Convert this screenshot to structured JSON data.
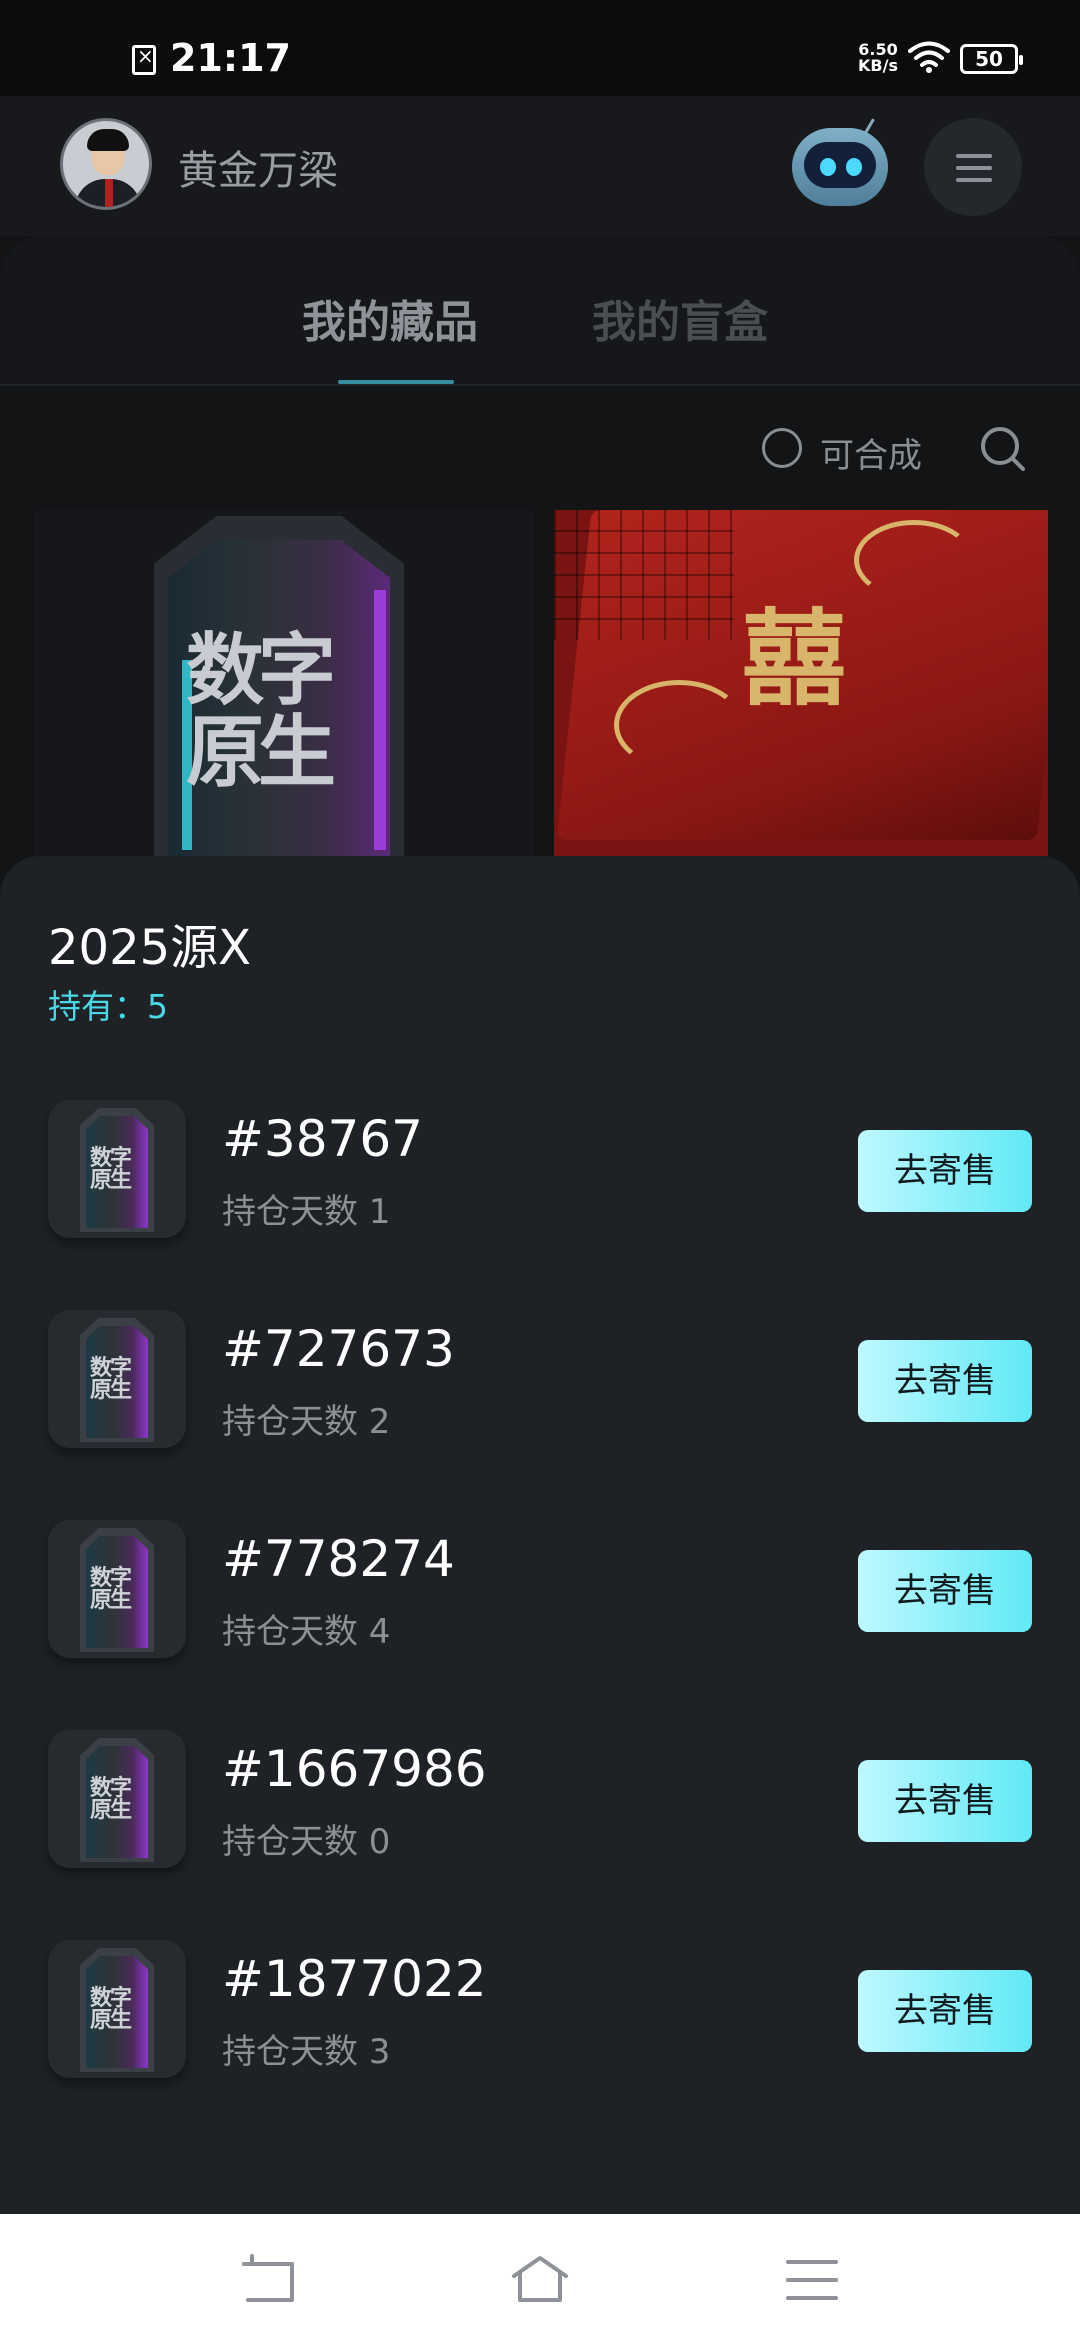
{
  "status_bar": {
    "time": "21:17",
    "network_speed": "6.50",
    "network_unit": "KB/s",
    "battery": "50",
    "icons": [
      "sim-error-icon",
      "wifi-icon",
      "battery-icon"
    ]
  },
  "header": {
    "username": "黄金万梁",
    "icons": [
      "avatar",
      "robot-assistant-icon",
      "menu-icon"
    ]
  },
  "tabs": [
    {
      "label": "我的藏品",
      "active": true
    },
    {
      "label": "我的盲盒",
      "active": false
    }
  ],
  "filter": {
    "synthesizable_label": "可合成",
    "synthesizable_checked": false,
    "search_icon": "search-icon"
  },
  "collections": [
    {
      "image": "digital-native-card",
      "caption_glyph": "数字原生"
    },
    {
      "image": "red-gift-box-card",
      "caption_glyph": "囍"
    }
  ],
  "sheet": {
    "title": "2025源X",
    "holding": "持有：5",
    "items": [
      {
        "id": "#38767",
        "days": "持仓天数 1",
        "button": "去寄售"
      },
      {
        "id": "#727673",
        "days": "持仓天数 2",
        "button": "去寄售"
      },
      {
        "id": "#778274",
        "days": "持仓天数 4",
        "button": "去寄售"
      },
      {
        "id": "#1667986",
        "days": "持仓天数 0",
        "button": "去寄售"
      },
      {
        "id": "#1877022",
        "days": "持仓天数 3",
        "button": "去寄售"
      }
    ]
  },
  "nav_bar": {
    "icons": [
      "back-icon",
      "home-icon",
      "recents-icon"
    ]
  },
  "colors": {
    "accent_cyan": "#49d8e6",
    "button_gradient_start": "#bff8ff",
    "button_gradient_end": "#60e9f5",
    "sheet_bg": "#1e2125"
  }
}
